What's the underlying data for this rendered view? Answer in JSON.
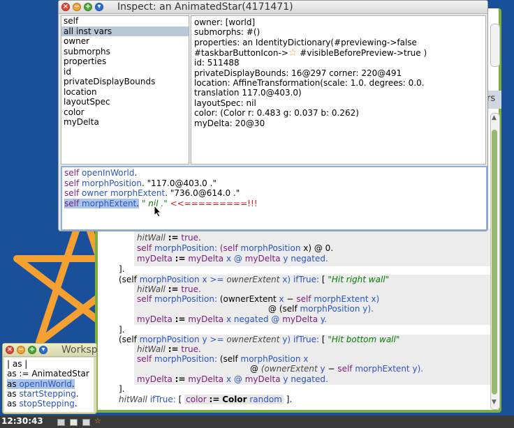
{
  "inspector": {
    "title": "Inspect: an AnimatedStar(4171471)",
    "fields": [
      "self",
      "all inst vars",
      "owner",
      "submorphs",
      "properties",
      "id",
      "privateDisplayBounds",
      "location",
      "layoutSpec",
      "color",
      "myDelta"
    ],
    "selected_field_index": 1,
    "values": [
      "owner:    [world]",
      "submorphs:  #()",
      "properties:    an IdentityDictionary(#previewing->false",
      "#taskbarButtonIcon->",
      "#visibleBeforePreview->true )",
      "id:   511488",
      "privateDisplayBounds:       16@297 corner: 220@491",
      "location:       AffineTransformation(scale: 1.0. degrees: 0.0.",
      "translation 117.0@403.0)",
      "layoutSpec:  nil",
      "color:      (Color r: 0.483 g: 0.037 b: 0.262)",
      "myDelta:        20@30"
    ],
    "eval": {
      "l1a": "self",
      "l1b": "openInWorld",
      "l1c": ".",
      "l2a": "self",
      "l2b": "morphPosition",
      "l2c": ". \"117.0@403.0 .\"",
      "l3a": "self",
      "l3b": "owner",
      "l3c": "morphExtent",
      "l3d": ". \"736.0@614.0 .\"",
      "l4a": "self",
      "l4b": "morphExtent",
      "l4c": ".",
      "l4d": "\" nil .\"",
      "l4e": "<<=========!!!"
    }
  },
  "code": {
    "partial_line": "hitWall := true.",
    "lines": {
      "a1": "hitWall",
      "a1b": ":=",
      "a1c": "true.",
      "a2": "self",
      "a2b": "morphPosition:",
      "a2c": "(self",
      "a2d": "morphPosition",
      "a2e": "x) @ 0.",
      "a3": "myDelta",
      "a3b": ":=",
      "a3c": "myDelta",
      "a3d": "x",
      "a3e": "@",
      "a3f": "myDelta",
      "a3g": "y",
      "a3h": "negated.",
      "close1": "].",
      "b0": "(self",
      "b0b": "morphPosition",
      "b0c": "x >=",
      "b0d": "ownerExtent",
      "b0e": "x)",
      "b0f": "ifTrue:",
      "b0g": "[",
      "b0h": "\"Hit right wall\"",
      "b1": "hitWall",
      "b1b": ":=",
      "b1c": "true.",
      "b2": "self",
      "b2b": "morphPosition:",
      "b2c": "(ownerExtent",
      "b2d": "x",
      "b2e": "−",
      "b2f": "self",
      "b2g": "morphExtent",
      "b2h": "x)",
      "b3": "@ (self",
      "b3b": "morphPosition",
      "b3c": "y).",
      "b4": "myDelta",
      "b4b": ":=",
      "b4c": "myDelta",
      "b4d": "x",
      "b4e": "negated",
      "b4f": "@",
      "b4g": "myDelta",
      "b4h": "y.",
      "close2": "].",
      "c0": "(self",
      "c0b": "morphPosition",
      "c0c": "y",
      "c0d": ">=",
      "c0e": "ownerExtent",
      "c0f": "y)",
      "c0g": "ifTrue:",
      "c0h": "[",
      "c0i": "\"Hit bottom wall\"",
      "c1": "hitWall",
      "c1b": ":=",
      "c1c": "true.",
      "c2": "self",
      "c2b": "morphPosition:",
      "c2c": "(self",
      "c2d": "morphPosition",
      "c2e": "x",
      "c3": "@",
      "c3b": "(ownerExtent",
      "c3c": "y",
      "c3d": "−",
      "c3e": "self",
      "c3f": "morphExtent",
      "c3g": "y).",
      "c4": "myDelta",
      "c4b": ":=",
      "c4c": "myDelta",
      "c4d": "x",
      "c4e": "@",
      "c4f": "myDelta",
      "c4g": "y",
      "c4h": "negated.",
      "close3": "].",
      "d0": "hitWall",
      "d0b": "ifTrue:",
      "d0c": "[",
      "d0d": "color",
      "d0e": ":=",
      "d0f": "Color",
      "d0g": "random",
      "d0h": "]."
    },
    "side_label": "rs"
  },
  "workspace": {
    "title": "Worksp",
    "lines": [
      {
        "a": "| as |"
      },
      {
        "a": "as := AnimatedStar"
      },
      {
        "a": "as",
        "b": "openInWorld",
        "c": "."
      },
      {
        "a": "as",
        "b": "startStepping",
        "c": "."
      },
      {
        "a": "as",
        "b": "stopStepping",
        "c": "."
      }
    ]
  },
  "taskbar": {
    "clock": "12:30:43"
  },
  "colors": {
    "desktop": "#1a4f9a",
    "star": "#f5a030",
    "window_border": "#7cae3e"
  }
}
